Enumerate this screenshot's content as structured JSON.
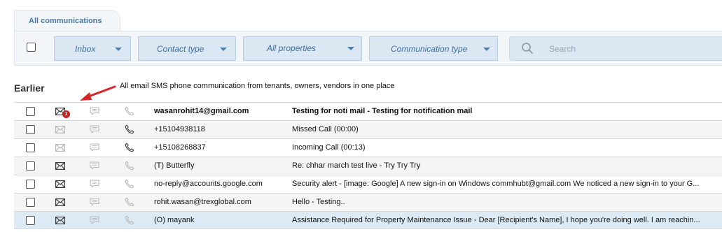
{
  "tabs": [
    {
      "label": "All communications"
    }
  ],
  "filters": {
    "inbox_label": "Inbox",
    "contact_type_label": "Contact type",
    "all_properties_label": "All properties",
    "communication_type_label": "Communication type",
    "search_placeholder": "Search"
  },
  "section_heading": "Earlier",
  "annotation": "All email SMS phone communication from tenants, owners, vendors in one place",
  "colors": {
    "accent": "#4a7aa6",
    "dropdown_bg": "#dbe8f3",
    "selected_row": "#dceaf5",
    "badge": "#cc1f1f",
    "arrow": "#d9252a"
  },
  "rows": [
    {
      "contact": "wasanrohit14@gmail.com",
      "subject": "Testing for noti mail - Testing for notification mail",
      "mail_active": true,
      "phone_active": false,
      "badge": "1",
      "unread": true
    },
    {
      "contact": "+15104938118",
      "subject": "Missed Call (00:00)",
      "mail_active": false,
      "phone_active": true,
      "badge": "",
      "unread": false
    },
    {
      "contact": "+15108268837",
      "subject": "Incoming Call (00:13)",
      "mail_active": false,
      "phone_active": true,
      "badge": "",
      "unread": false
    },
    {
      "contact": "(T) Butterfly",
      "subject": "Re: chhar march test live - Try Try Try",
      "mail_active": true,
      "phone_active": false,
      "badge": "",
      "unread": false
    },
    {
      "contact": "no-reply@accounts.google.com",
      "subject": "Security alert - [image: Google] A new sign-in on Windows commhubt@gmail.com We noticed a new sign-in to your G...",
      "mail_active": true,
      "phone_active": false,
      "badge": "",
      "unread": false
    },
    {
      "contact": "rohit.wasan@trexglobal.com",
      "subject": "Hello - Testing..",
      "mail_active": true,
      "phone_active": false,
      "badge": "",
      "unread": false
    },
    {
      "contact": "(O) mayank",
      "subject": "Assistance Required for Property Maintenance Issue - Dear [Recipient's Name], I hope you're doing well. I am reachin...",
      "mail_active": true,
      "phone_active": false,
      "badge": "",
      "unread": false
    }
  ]
}
